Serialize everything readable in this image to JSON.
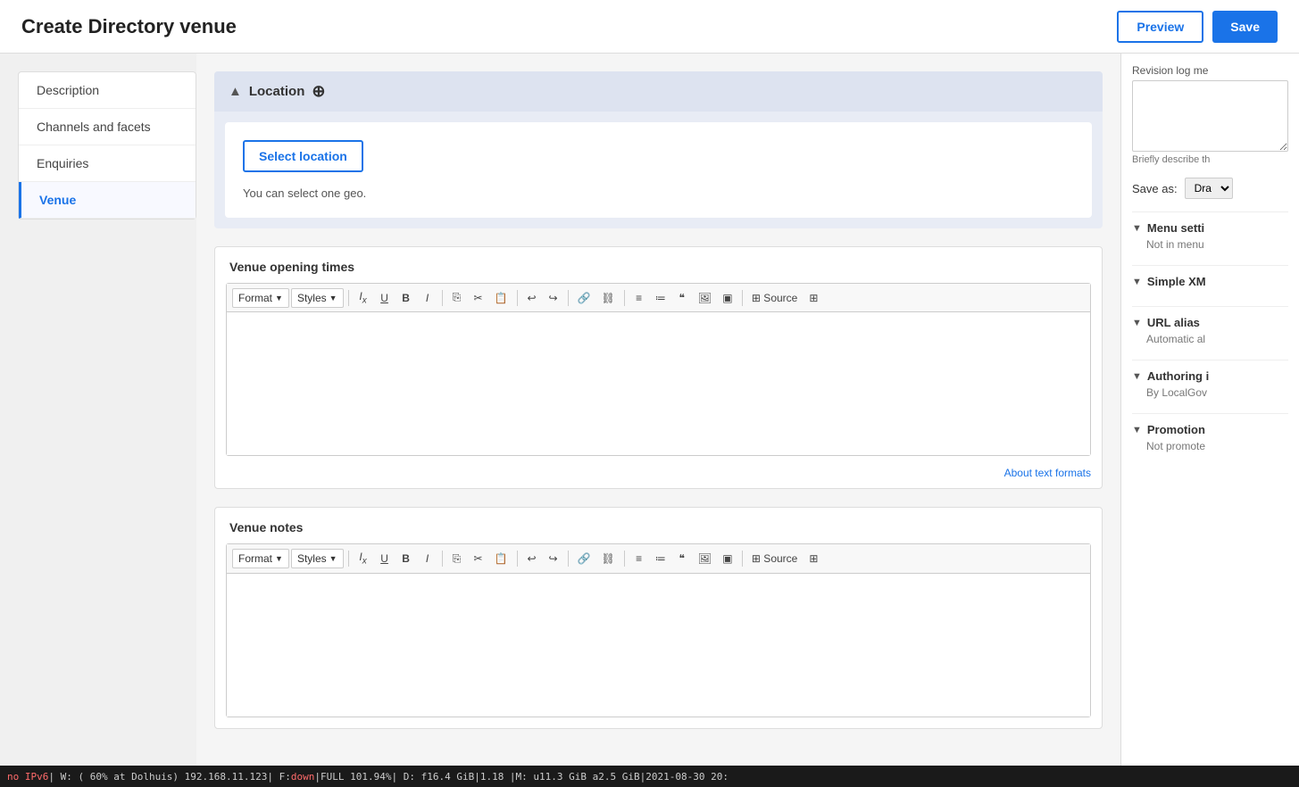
{
  "header": {
    "title": "Create Directory venue",
    "preview_label": "Preview",
    "save_label": "Save"
  },
  "sidebar": {
    "items": [
      {
        "id": "description",
        "label": "Description",
        "active": false
      },
      {
        "id": "channels",
        "label": "Channels and facets",
        "active": false
      },
      {
        "id": "enquiries",
        "label": "Enquiries",
        "active": false
      },
      {
        "id": "venue",
        "label": "Venue",
        "active": true
      }
    ]
  },
  "location": {
    "section_title": "Location",
    "select_button_label": "Select location",
    "hint_text": "You can select one geo."
  },
  "venue_opening_times": {
    "section_title": "Venue opening times",
    "format_label": "Format",
    "styles_label": "Styles",
    "about_formats_link": "About text formats"
  },
  "venue_notes": {
    "section_title": "Venue notes",
    "format_label": "Format",
    "styles_label": "Styles"
  },
  "right_panel": {
    "revision_log_label": "Revision log me",
    "revision_log_placeholder": "",
    "brief_hint": "Briefly describe th",
    "save_as_label": "Save as:",
    "save_as_value": "Dra",
    "menu_settings": {
      "title": "Menu setti",
      "value": "Not in menu"
    },
    "simple_xml": {
      "title": "Simple XM"
    },
    "url_alias": {
      "title": "URL alias",
      "value": "Automatic al"
    },
    "authoring": {
      "title": "Authoring i",
      "value": "By LocalGov"
    },
    "promotion": {
      "title": "Promotion",
      "value": "Not promote"
    }
  },
  "status_bar": {
    "text": "no IPv6| W: ( 60% at Dolhuis) 192.168.11.123| F: down|FULL 101.94%| D: f16.4 GiB|1.18 |M: u11.3 GiB a2.5 GiB|2021-08-30 20:"
  },
  "toolbar": {
    "format_label": "Format",
    "styles_label": "Styles",
    "buttons": [
      "Ix",
      "U",
      "B",
      "I",
      "copy",
      "cut",
      "paste",
      "undo",
      "redo",
      "link",
      "unlink",
      "ul",
      "ol",
      "quote",
      "img",
      "embed",
      "source",
      "table"
    ]
  }
}
